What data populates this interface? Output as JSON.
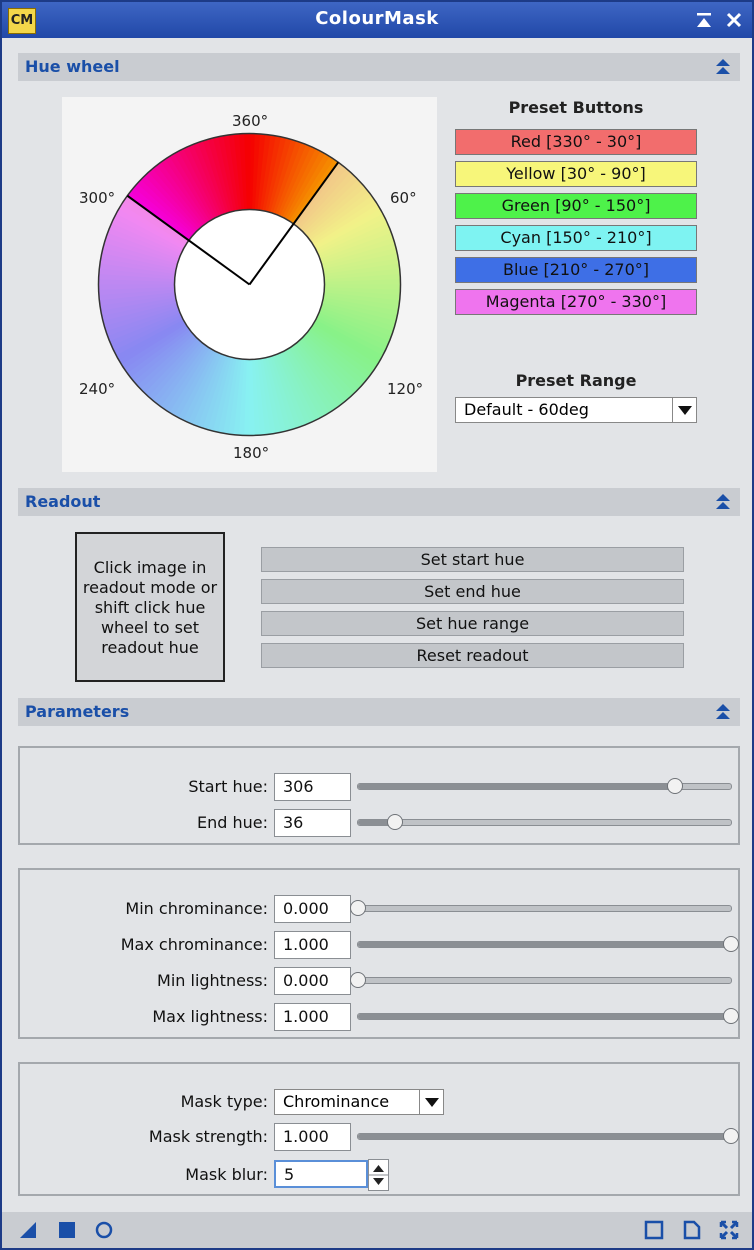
{
  "window": {
    "title": "ColourMask",
    "app_icon_label": "CM",
    "titlebar_buttons": [
      "collapse-icon",
      "close-icon"
    ]
  },
  "hue_wheel": {
    "section_title": "Hue wheel",
    "degree_labels": {
      "top": "360°",
      "upper_left": "300°",
      "upper_right": "60°",
      "lower_left": "240°",
      "lower_right": "120°",
      "bottom": "180°"
    },
    "selected_range": {
      "start": 306,
      "end": 36
    },
    "preset_buttons_title": "Preset Buttons",
    "preset_buttons": [
      {
        "label": "Red [330° - 30°]",
        "color": "#f26d6d"
      },
      {
        "label": "Yellow [30° - 90°]",
        "color": "#f7f67a"
      },
      {
        "label": "Green [90° - 150°]",
        "color": "#4ef24a"
      },
      {
        "label": "Cyan [150° - 210°]",
        "color": "#7ef3f2"
      },
      {
        "label": "Blue [210° - 270°]",
        "color": "#3e6fe6"
      },
      {
        "label": "Magenta [270° - 330°]",
        "color": "#ef74ee"
      }
    ],
    "preset_range_title": "Preset Range",
    "preset_range_value": "Default - 60deg"
  },
  "readout": {
    "section_title": "Readout",
    "info_lines": [
      "Click image in",
      "readout mode or",
      "shift click hue",
      "wheel to set",
      "readout hue"
    ],
    "buttons": [
      "Set start hue",
      "Set end hue",
      "Set hue range",
      "Reset readout"
    ]
  },
  "parameters": {
    "section_title": "Parameters",
    "start_hue": {
      "label": "Start hue:",
      "value": "306",
      "level": 0.85
    },
    "end_hue": {
      "label": "End hue:",
      "value": "36",
      "level": 0.1
    },
    "min_chrominance": {
      "label": "Min chrominance:",
      "value": "0.000",
      "level": 0.0
    },
    "max_chrominance": {
      "label": "Max chrominance:",
      "value": "1.000",
      "level": 1.0
    },
    "min_lightness": {
      "label": "Min lightness:",
      "value": "0.000",
      "level": 0.0
    },
    "max_lightness": {
      "label": "Max lightness:",
      "value": "1.000",
      "level": 1.0
    },
    "mask_type": {
      "label": "Mask type:",
      "value": "Chrominance"
    },
    "mask_strength": {
      "label": "Mask strength:",
      "value": "1.000",
      "level": 1.0
    },
    "mask_blur": {
      "label": "Mask blur:",
      "value": "5"
    }
  },
  "bottom_bar": {
    "left_icons": [
      "new-instance-icon",
      "apply-square-icon",
      "apply-global-circle-icon"
    ],
    "right_icons": [
      "preview-icon",
      "documentation-icon",
      "reset-icon"
    ]
  },
  "colors": {
    "accent": "#1a4fa8",
    "titlebar": "#2b52b3"
  }
}
